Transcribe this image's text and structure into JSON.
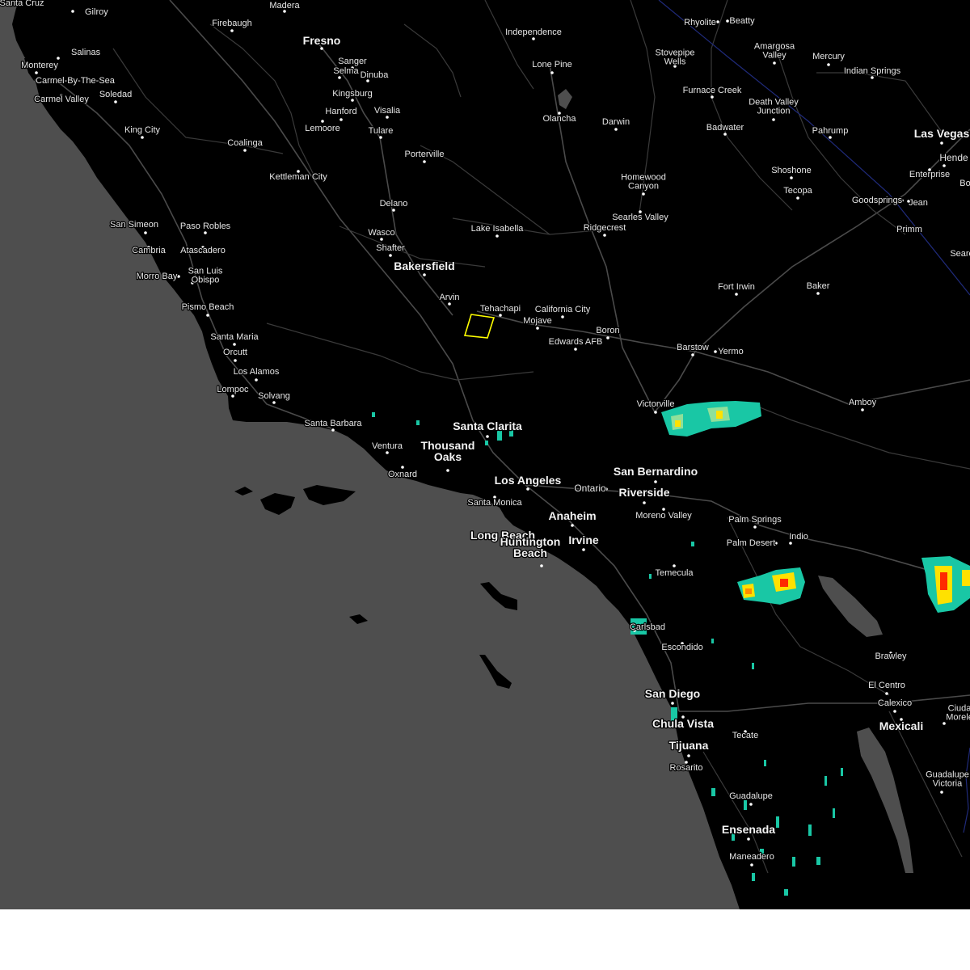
{
  "map": {
    "colors": {
      "ocean": "#4e4e4e",
      "land": "#000000",
      "roads": "#3a3a3a",
      "labels": "#e6e6e6",
      "warning_polygon": "#ffff00",
      "state_border": "#1f2a7a",
      "radar_light": "#19c7a5",
      "radar_medium": "#ffe100",
      "radar_heavy": "#ff2a00"
    },
    "places": [
      {
        "name": "Santa Cruz"
      },
      {
        "name": "Gilroy"
      },
      {
        "name": "Madera"
      },
      {
        "name": "Firebaugh"
      },
      {
        "name": "Fresno"
      },
      {
        "name": "Salinas"
      },
      {
        "name": "Monterey"
      },
      {
        "name": "Carmel-By-The-Sea"
      },
      {
        "name": "Sanger"
      },
      {
        "name": "Selma"
      },
      {
        "name": "Dinuba"
      },
      {
        "name": "Carmel Valley"
      },
      {
        "name": "Soledad"
      },
      {
        "name": "Kingsburg"
      },
      {
        "name": "Hanford"
      },
      {
        "name": "Visalia"
      },
      {
        "name": "Lemoore"
      },
      {
        "name": "Tulare"
      },
      {
        "name": "King City"
      },
      {
        "name": "Coalinga"
      },
      {
        "name": "Porterville"
      },
      {
        "name": "Kettleman City"
      },
      {
        "name": "Delano"
      },
      {
        "name": "San Simeon"
      },
      {
        "name": "Paso Robles"
      },
      {
        "name": "Wasco"
      },
      {
        "name": "Cambria"
      },
      {
        "name": "Atascadero"
      },
      {
        "name": "Shafter"
      },
      {
        "name": "Bakersfield"
      },
      {
        "name": "Morro Bay"
      },
      {
        "name": "San Luis Obispo"
      },
      {
        "name": "Pismo Beach"
      },
      {
        "name": "Arvin"
      },
      {
        "name": "Tehachapi"
      },
      {
        "name": "Santa Maria"
      },
      {
        "name": "Orcutt"
      },
      {
        "name": "Los Alamos"
      },
      {
        "name": "Lompoc"
      },
      {
        "name": "Solvang"
      },
      {
        "name": "Santa Barbara"
      },
      {
        "name": "Ventura"
      },
      {
        "name": "Oxnard"
      },
      {
        "name": "Thousand Oaks"
      },
      {
        "name": "Santa Clarita"
      },
      {
        "name": "Los Angeles"
      },
      {
        "name": "Santa Monica"
      },
      {
        "name": "Independence"
      },
      {
        "name": "Lone Pine"
      },
      {
        "name": "Olancha"
      },
      {
        "name": "Darwin"
      },
      {
        "name": "Lake Isabella"
      },
      {
        "name": "Ridgecrest"
      },
      {
        "name": "California City"
      },
      {
        "name": "Mojave"
      },
      {
        "name": "Edwards AFB"
      },
      {
        "name": "Boron"
      },
      {
        "name": "Homewood Canyon"
      },
      {
        "name": "Searles Valley"
      },
      {
        "name": "Rhyolite"
      },
      {
        "name": "Beatty"
      },
      {
        "name": "Stovepipe Wells"
      },
      {
        "name": "Amargosa Valley"
      },
      {
        "name": "Mercury"
      },
      {
        "name": "Indian Springs"
      },
      {
        "name": "Furnace Creek"
      },
      {
        "name": "Death Valley Junction"
      },
      {
        "name": "Badwater"
      },
      {
        "name": "Pahrump"
      },
      {
        "name": "Las Vegas"
      },
      {
        "name": "Hende"
      },
      {
        "name": "Enterprise"
      },
      {
        "name": "Bo"
      },
      {
        "name": "Shoshone"
      },
      {
        "name": "Tecopa"
      },
      {
        "name": "Goodsprings"
      },
      {
        "name": "Jean"
      },
      {
        "name": "Primm"
      },
      {
        "name": "Seare"
      },
      {
        "name": "Fort Irwin"
      },
      {
        "name": "Baker"
      },
      {
        "name": "Barstow"
      },
      {
        "name": "Yermo"
      },
      {
        "name": "Victorville"
      },
      {
        "name": "Amboy"
      },
      {
        "name": "San Bernardino"
      },
      {
        "name": "Ontario"
      },
      {
        "name": "Riverside"
      },
      {
        "name": "Anaheim"
      },
      {
        "name": "Moreno Valley"
      },
      {
        "name": "Long Beach"
      },
      {
        "name": "Irvine"
      },
      {
        "name": "Huntington Beach"
      },
      {
        "name": "Palm Springs"
      },
      {
        "name": "Palm Desert"
      },
      {
        "name": "Indio"
      },
      {
        "name": "Temecula"
      },
      {
        "name": "Carlsbad"
      },
      {
        "name": "Escondido"
      },
      {
        "name": "Brawley"
      },
      {
        "name": "San Diego"
      },
      {
        "name": "El Centro"
      },
      {
        "name": "Calexico"
      },
      {
        "name": "Chula Vista"
      },
      {
        "name": "Mexicali"
      },
      {
        "name": "Ciuda Morele"
      },
      {
        "name": "Tijuana"
      },
      {
        "name": "Tecate"
      },
      {
        "name": "Rosarito"
      },
      {
        "name": "Guadalupe Victoria"
      },
      {
        "name": "Guadalupe"
      },
      {
        "name": "Ensenada"
      },
      {
        "name": "Maneadero"
      }
    ]
  }
}
